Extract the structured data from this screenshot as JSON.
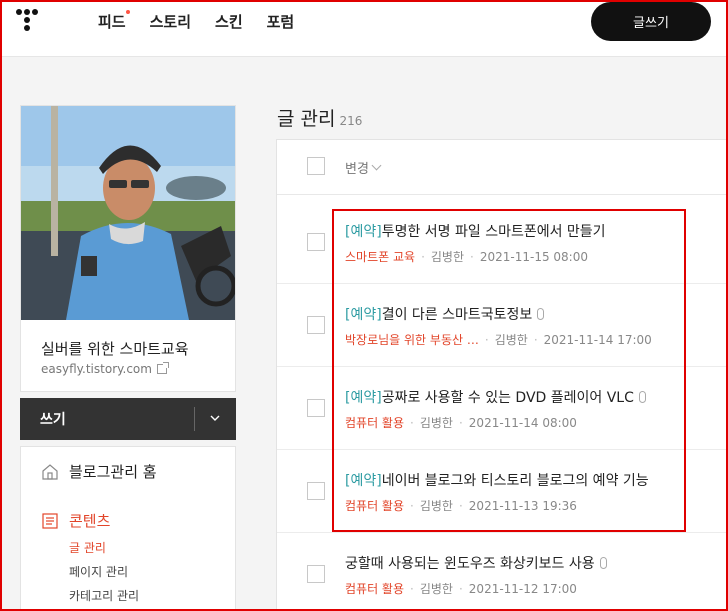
{
  "nav": {
    "items": [
      "피드",
      "스토리",
      "스킨",
      "포럼"
    ],
    "write_label": "글쓰기"
  },
  "sidebar": {
    "blog_name": "실버를 위한 스마트교육",
    "blog_url": "easyfly.tistory.com",
    "write_bar_label": "쓰기",
    "menu": {
      "home": "블로그관리 홈",
      "content": "콘텐츠",
      "sub": [
        "글 관리",
        "페이지 관리",
        "카테고리 관리"
      ]
    }
  },
  "main": {
    "title": "글 관리",
    "count": "216",
    "header_label": "변경",
    "posts": [
      {
        "tag": "[예약]",
        "title": "투명한 서명 파일 스마트폰에서 만들기",
        "category": "스마트폰 교육",
        "author": "김병한",
        "date": "2021-11-15 08:00"
      },
      {
        "tag": "[예약]",
        "title": "결이 다른 스마트국토정보",
        "category": "박장로님을 위한 부동산 …",
        "author": "김병한",
        "date": "2021-11-14 17:00"
      },
      {
        "tag": "[예약]",
        "title": "공짜로 사용할 수 있는 DVD 플레이어 VLC",
        "category": "컴퓨터 활용",
        "author": "김병한",
        "date": "2021-11-14 08:00"
      },
      {
        "tag": "[예약]",
        "title": "네이버 블로그와 티스토리 블로그의 예약 기능",
        "category": "컴퓨터 활용",
        "author": "김병한",
        "date": "2021-11-13 19:36"
      },
      {
        "tag": "",
        "title": "궁할때 사용되는 윈도우즈 화상키보드 사용",
        "category": "컴퓨터 활용",
        "author": "김병한",
        "date": "2021-11-12 17:00"
      }
    ]
  },
  "colors": {
    "accent": "#e2452a",
    "reserve": "#2e9ca3",
    "highlight": "#e00000"
  }
}
